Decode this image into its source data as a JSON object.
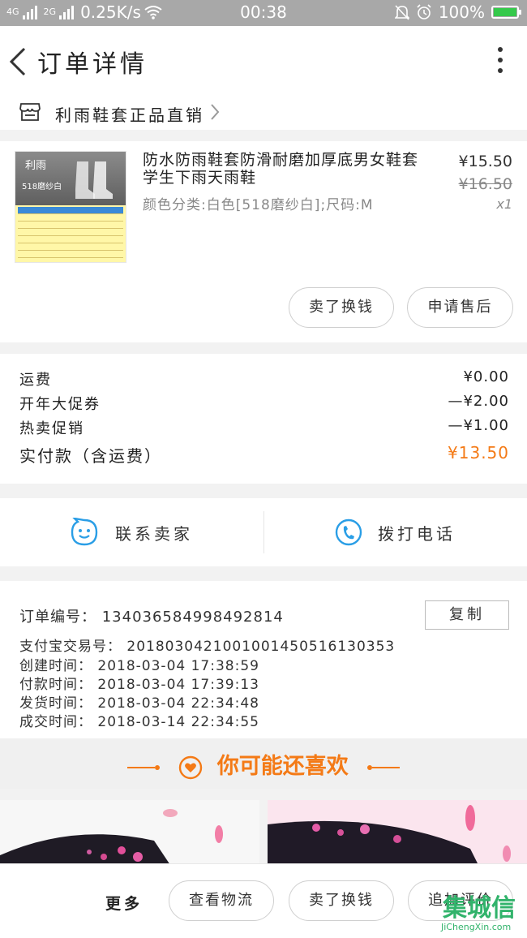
{
  "status_bar": {
    "signal_1": "4G",
    "signal_2": "2G",
    "speed": "0.25K/s",
    "time": "00:38",
    "battery": "100%"
  },
  "header": {
    "title": "订单详情"
  },
  "shop": {
    "name": "利雨鞋套正品直销"
  },
  "product": {
    "thumb_brand": "利雨",
    "thumb_sub": "518磨纱白",
    "title": "防水防雨鞋套防滑耐磨加厚底男女鞋套学生下雨天雨鞋",
    "spec": "颜色分类:白色[518磨纱白];尺码:M",
    "price": "¥15.50",
    "original_price": "¥16.50",
    "quantity": "x1",
    "sell_button": "卖了换钱",
    "after_sale_button": "申请售后"
  },
  "fees": {
    "rows": [
      {
        "label": "运费",
        "value": "¥0.00"
      },
      {
        "label": "开年大促券",
        "value": "—¥2.00"
      },
      {
        "label": "热卖促销",
        "value": "—¥1.00"
      }
    ],
    "total_label": "实付款（含运费）",
    "total_value": "¥13.50"
  },
  "contact": {
    "seller": "联系卖家",
    "phone": "拨打电话"
  },
  "order_info": {
    "order_no": "订单编号： 134036584998492814",
    "copy_button": "复制",
    "alipay_no": "支付宝交易号： 2018030421001001450516130353",
    "created": "创建时间： 2018-03-04 17:38:59",
    "paid": "付款时间： 2018-03-04 17:39:13",
    "shipped": "发货时间： 2018-03-04 22:34:48",
    "completed": "成交时间： 2018-03-14 22:34:55"
  },
  "recommend": {
    "title": "你可能还喜欢"
  },
  "bottom_bar": {
    "more": "更多",
    "logistics": "查看物流",
    "sell": "卖了换钱",
    "review": "追加评价"
  },
  "watermark": {
    "main": "集城信",
    "sub": "JiChengXin.com"
  },
  "colors": {
    "accent": "#f47a16",
    "link_blue": "#2a9ee6",
    "status_bar": "#a8a8a8"
  }
}
